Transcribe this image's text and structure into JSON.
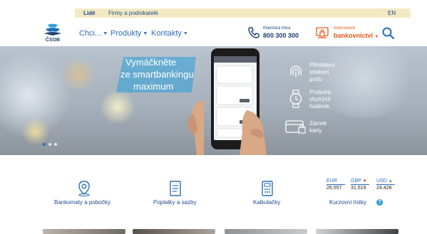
{
  "topbar": {
    "segments": [
      "Lidé",
      "Firmy a podnikatelé"
    ],
    "language": "EN"
  },
  "header": {
    "logo_text": "ČSOB",
    "nav": [
      {
        "label": "Chci..."
      },
      {
        "label": "Produkty"
      },
      {
        "label": "Kontakty"
      }
    ],
    "hotline_label": "Klientská linka",
    "hotline_number": "800 300 300",
    "ib_label": "Internetové",
    "ib_label2": "bankovnictví"
  },
  "hero": {
    "title_lines": [
      "Vymáčkněte",
      "ze smartbankingu",
      "maximum"
    ],
    "features": [
      {
        "icon": "fingerprint-icon",
        "lines": [
          "Přihlášení",
          "otiskem",
          "prstu"
        ]
      },
      {
        "icon": "smartwatch-icon",
        "lines": [
          "Podpora",
          "chytrých",
          "hodinek"
        ]
      },
      {
        "icon": "card-lock-icon",
        "lines": [
          "Zámek",
          "karty"
        ]
      }
    ],
    "slides_count": 3,
    "active_slide": 1
  },
  "services": [
    {
      "icon": "location-pin-icon",
      "label": "Bankomaty a pobočky"
    },
    {
      "icon": "document-icon",
      "label": "Poplatky a sazby"
    },
    {
      "icon": "calculator-icon",
      "label": "Kalkulačky"
    },
    {
      "label": "Kurzovní lístky"
    }
  ],
  "currencies": [
    {
      "code": "EUR",
      "value": "26,557",
      "trend": "none"
    },
    {
      "code": "GBP",
      "value": "31,519",
      "trend": "down"
    },
    {
      "code": "USD",
      "value": "24,428",
      "trend": "up"
    }
  ],
  "colors": {
    "brand_blue": "#2a6ebb",
    "dark_blue": "#1d3f75",
    "orange": "#e35a1c",
    "topbar_gold": "#f3eac4"
  }
}
